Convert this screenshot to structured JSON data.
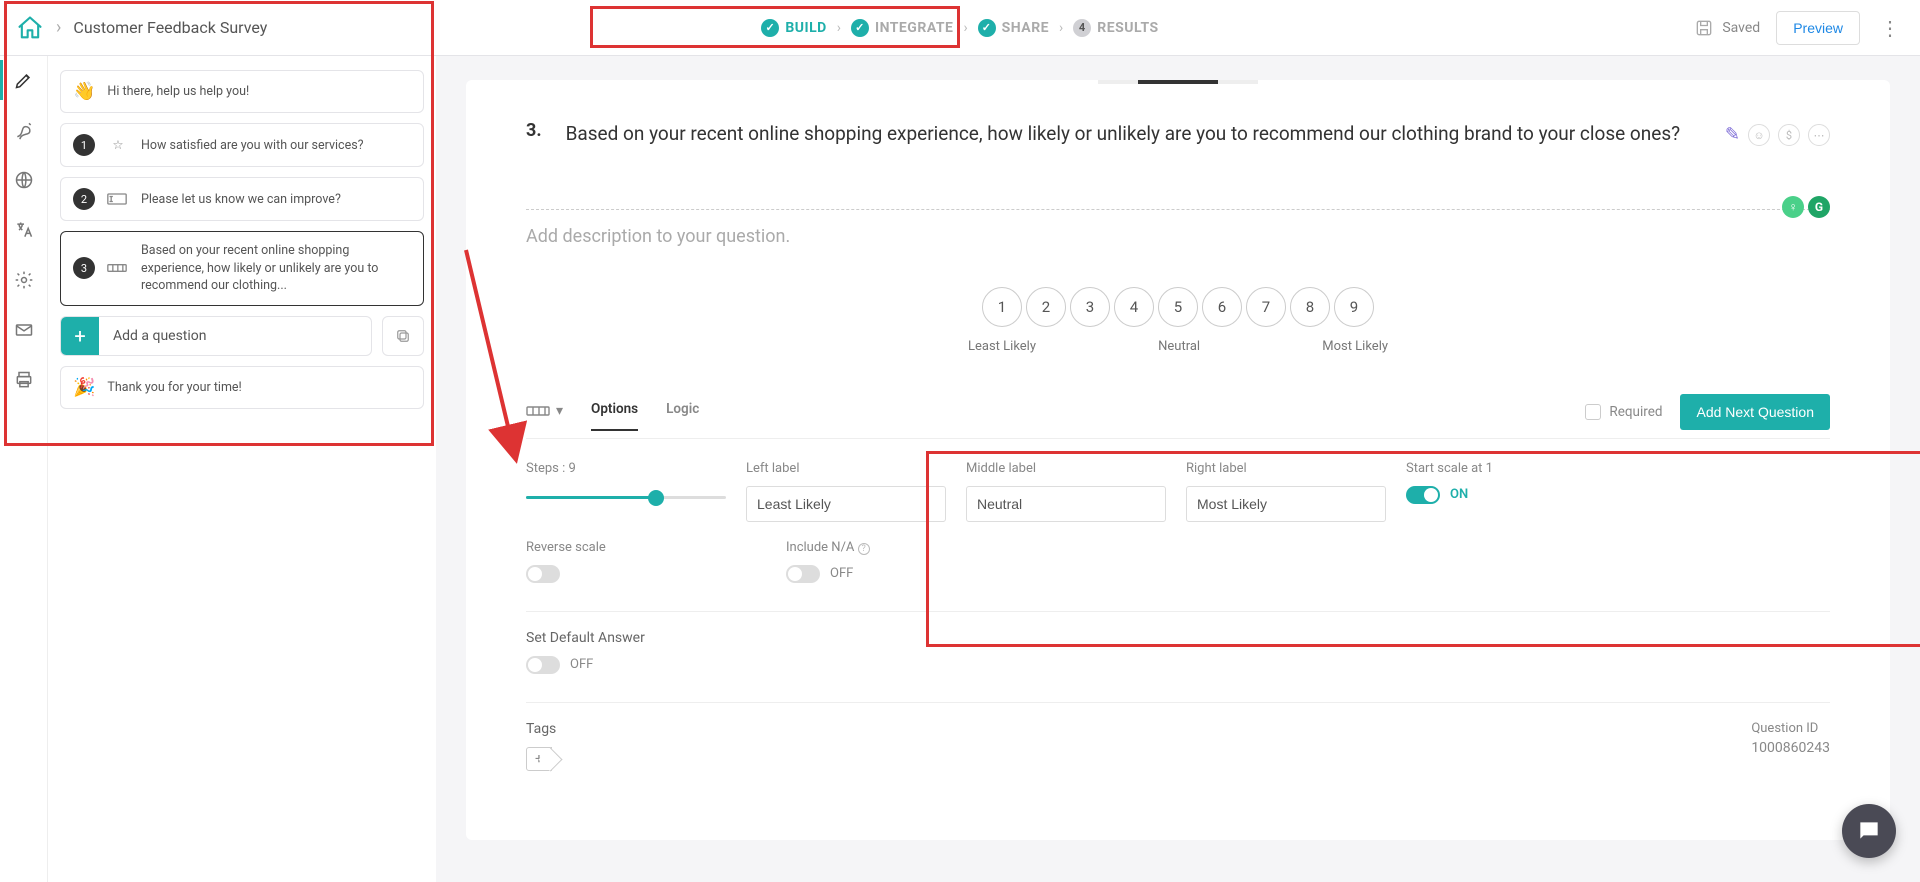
{
  "header": {
    "title": "Customer Feedback Survey",
    "steps": [
      "BUILD",
      "INTEGRATE",
      "SHARE",
      "RESULTS"
    ],
    "active_step": 0,
    "saved_label": "Saved",
    "preview_label": "Preview"
  },
  "sidebar": {
    "intro_label": "Hi there, help us help you!",
    "questions": [
      {
        "num": "1",
        "text": "How satisfied are you with our services?"
      },
      {
        "num": "2",
        "text": "Please let us know we can improve?"
      },
      {
        "num": "3",
        "text": "Based on your recent online shopping experience, how likely or unlikely are you to recommend our clothing..."
      }
    ],
    "add_label": "Add a question",
    "thankyou_label": "Thank you for your time!"
  },
  "editor": {
    "question_number": "3.",
    "question_text": "Based on your recent online shopping experience, how likely or unlikely are you to recommend our clothing brand to your close ones?",
    "description_placeholder": "Add description to your question.",
    "scale_values": [
      "1",
      "2",
      "3",
      "4",
      "5",
      "6",
      "7",
      "8",
      "9"
    ],
    "scale_left": "Least Likely",
    "scale_mid": "Neutral",
    "scale_right": "Most Likely"
  },
  "options_panel": {
    "tabs": {
      "options": "Options",
      "logic": "Logic"
    },
    "required_label": "Required",
    "add_next_label": "Add Next Question",
    "steps_label": "Steps : 9",
    "left_label_caption": "Left label",
    "middle_label_caption": "Middle label",
    "right_label_caption": "Right label",
    "left_label_value": "Least Likely",
    "middle_label_value": "Neutral",
    "right_label_value": "Most Likely",
    "start_at_1_label": "Start scale at 1",
    "on_label": "ON",
    "off_label": "OFF",
    "reverse_label": "Reverse scale",
    "include_na_label": "Include N/A",
    "default_answer_label": "Set Default Answer",
    "tags_label": "Tags",
    "question_id_label": "Question ID",
    "question_id_value": "1000860243"
  }
}
